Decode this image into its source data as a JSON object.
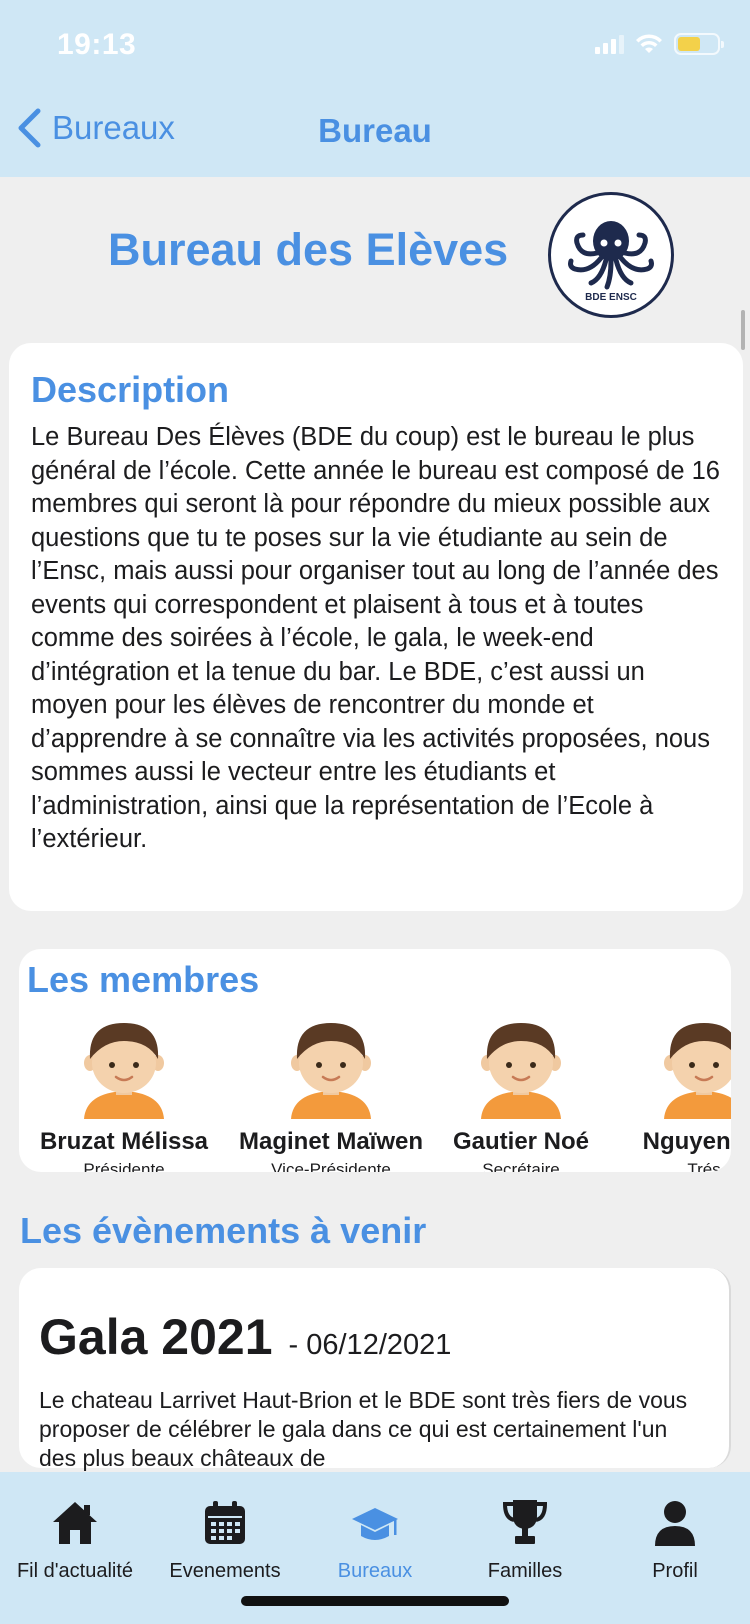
{
  "status_bar": {
    "time": "19:13"
  },
  "nav": {
    "back_label": "Bureaux",
    "title": "Bureau"
  },
  "bureau": {
    "name": "Bureau des Elèves",
    "logo_text": "BDE ENSC"
  },
  "description": {
    "title": "Description",
    "text": "Le Bureau Des Élèves (BDE du coup) est le bureau le plus général de l’école. Cette année le bureau est composé de 16 membres qui seront là pour répondre du mieux possible aux questions que tu te poses sur la vie étudiante au sein de l’Ensc, mais aussi pour organiser tout au long de l’année des events qui correspondent et plaisent à tous et à toutes comme des soirées à l’école, le gala, le week-end d’intégration et la tenue du bar. Le BDE, c’est aussi un moyen pour les élèves de rencontrer du monde et d’apprendre à se connaître via les activités proposées, nous sommes aussi le vecteur entre les étudiants et l’administration, ainsi que la représentation de l’Ecole à l’extérieur."
  },
  "members": {
    "title": "Les membres",
    "items": [
      {
        "name": "Bruzat Mélissa",
        "role": "Présidente"
      },
      {
        "name": "Maginet Maïwen",
        "role": "Vice-Présidente"
      },
      {
        "name": "Gautier Noé",
        "role": "Secrétaire"
      },
      {
        "name": "Nguyen Va",
        "role": "Trés"
      }
    ]
  },
  "events": {
    "title": "Les évènements à venir",
    "items": [
      {
        "name": "Gala 2021",
        "date": "- 06/12/2021",
        "description": "Le chateau Larrivet Haut-Brion et le BDE sont très fiers de vous proposer de célébrer le gala dans ce qui est certainement l'un des plus beaux châteaux de"
      }
    ]
  },
  "tabs": [
    {
      "label": "Fil d'actualité",
      "icon": "home-icon"
    },
    {
      "label": "Evenements",
      "icon": "calendar-icon"
    },
    {
      "label": "Bureaux",
      "icon": "graduation-cap-icon",
      "active": true
    },
    {
      "label": "Familles",
      "icon": "trophy-icon"
    },
    {
      "label": "Profil",
      "icon": "user-icon"
    }
  ],
  "colors": {
    "accent": "#4a90e2",
    "header_bg": "#cfe7f5",
    "page_bg": "#efefef"
  }
}
